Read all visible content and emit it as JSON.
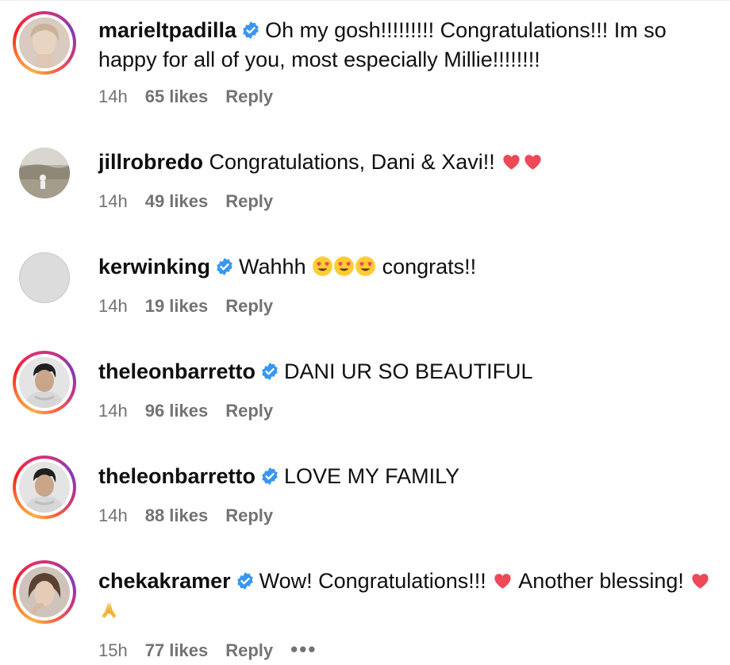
{
  "comments": [
    {
      "username": "marieltpadilla",
      "verified": true,
      "text_1": "Oh my gosh!!!!!!!!! Congratulations!!! Im so happy for all of you, most especially Millie!!!!!!!!",
      "time": "14h",
      "likes": "65 likes",
      "reply": "Reply",
      "ring": true
    },
    {
      "username": "jillrobredo",
      "verified": false,
      "text_1": "Congratulations, Dani & Xavi!! ",
      "emojis": "❤️❤️",
      "time": "14h",
      "likes": "49 likes",
      "reply": "Reply",
      "ring": false
    },
    {
      "username": "kerwinking",
      "verified": true,
      "text_1": "Wahhh ",
      "emojis": "😍😍😍",
      "text_2": " congrats!!",
      "time": "14h",
      "likes": "19 likes",
      "reply": "Reply",
      "ring": false
    },
    {
      "username": "theleonbarretto",
      "verified": true,
      "text_1": "DANI UR SO BEAUTIFUL",
      "time": "14h",
      "likes": "96 likes",
      "reply": "Reply",
      "ring": true
    },
    {
      "username": "theleonbarretto",
      "verified": true,
      "text_1": "LOVE MY FAMILY",
      "time": "14h",
      "likes": "88 likes",
      "reply": "Reply",
      "ring": true
    },
    {
      "username": "chekakramer",
      "verified": true,
      "text_1": "Wow! Congratulations!!! ",
      "emoji_a": "❤️",
      "text_2": " Another blessing! ",
      "emoji_b": "❤️🙏",
      "time": "15h",
      "likes": "77 likes",
      "reply": "Reply",
      "more": "•••",
      "ring": true
    }
  ],
  "icons": {
    "verified": "verified-badge-icon",
    "heart": "red-heart-emoji",
    "heart_eyes": "heart-eyes-emoji",
    "pray": "folded-hands-emoji",
    "more": "more-options-icon"
  },
  "colors": {
    "verified": "#3897f0",
    "meta": "#737373",
    "heart": "#ed4956"
  }
}
